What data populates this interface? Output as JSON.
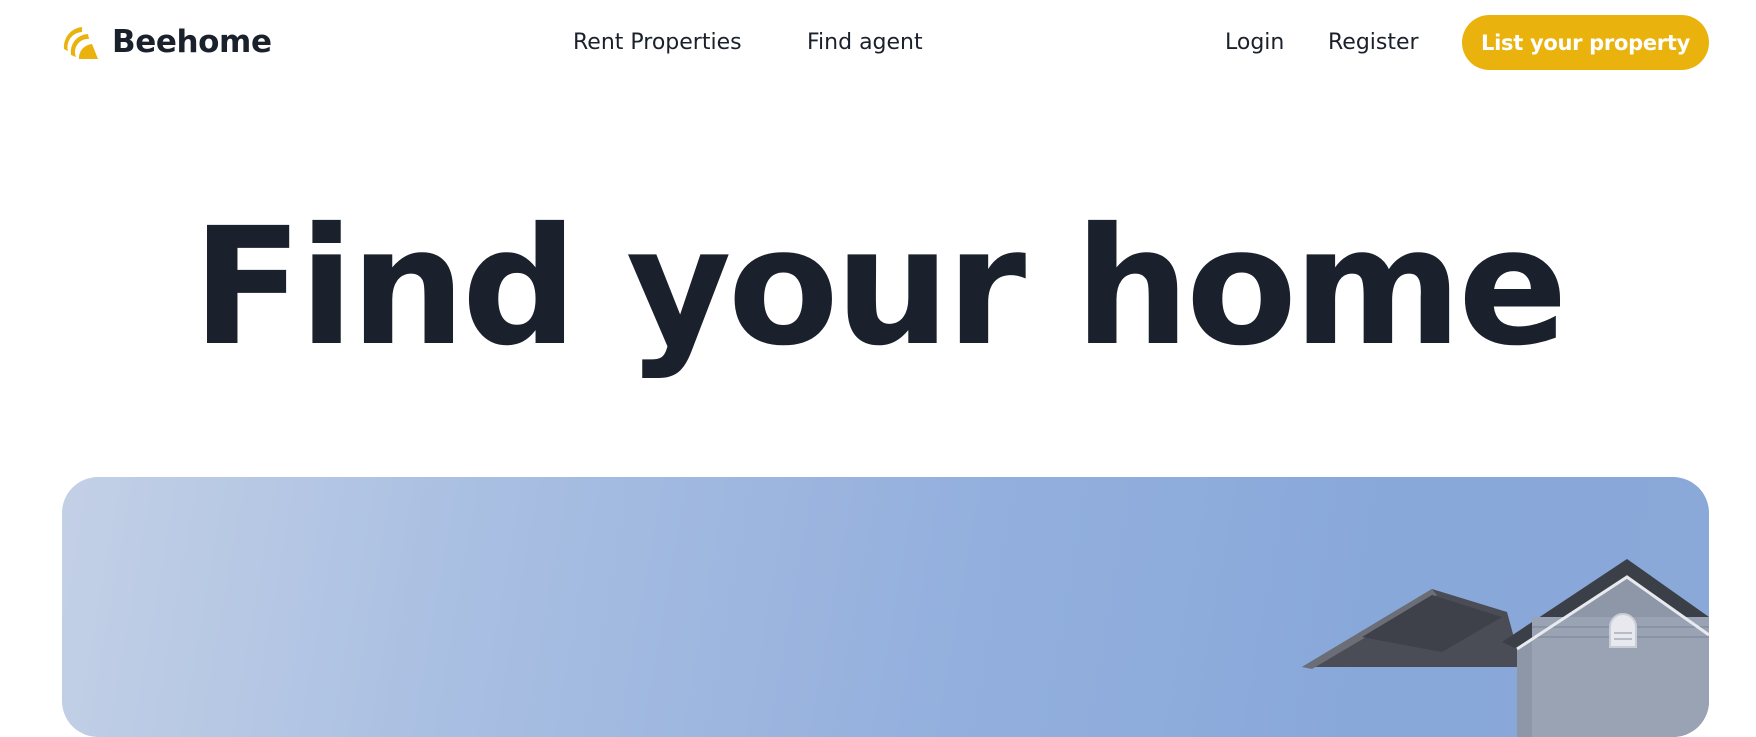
{
  "brand": {
    "name": "Beehome",
    "logo_icon": "bee-stripes-icon",
    "accent_color": "#e9b20c"
  },
  "nav": {
    "rent_properties": "Rent Properties",
    "find_agent": "Find agent",
    "login": "Login",
    "register": "Register",
    "cta_label": "List your property"
  },
  "hero": {
    "title": "Find your home",
    "image_subject": "house-roof-against-blue-sky"
  },
  "colors": {
    "text": "#1b212c",
    "accent": "#e9b20c",
    "background": "#ffffff",
    "sky": "#8aa8d8"
  }
}
